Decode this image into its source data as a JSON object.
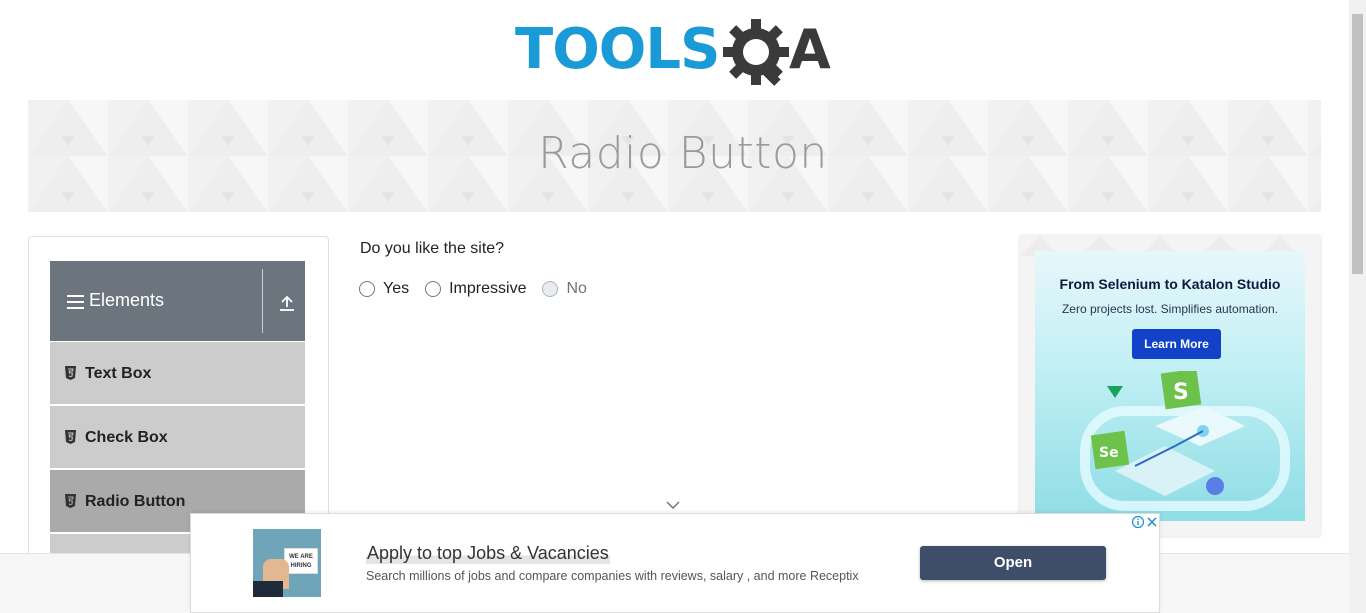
{
  "logo": {
    "text_part1": "TOOLS",
    "text_part2": "A",
    "colors": {
      "blue": "#1b9ad8",
      "dark": "#3a3a3a"
    }
  },
  "banner": {
    "title": "Radio Button"
  },
  "sidebar": {
    "group_title": "Elements",
    "items": [
      {
        "label": "Text Box",
        "active": false
      },
      {
        "label": "Check Box",
        "active": false
      },
      {
        "label": "Radio Button",
        "active": true
      }
    ]
  },
  "main": {
    "question": "Do you like the site?",
    "options": [
      {
        "label": "Yes",
        "disabled": false
      },
      {
        "label": "Impressive",
        "disabled": false
      },
      {
        "label": "No",
        "disabled": true
      }
    ]
  },
  "ad_right": {
    "title": "From Selenium to Katalon Studio",
    "subtitle": "Zero projects lost. Simplifies automation.",
    "button": "Learn More"
  },
  "ad_bottom": {
    "image_text": "WE ARE HIRING",
    "headline": "Apply to top Jobs & Vacancies",
    "description": "Search millions of jobs and compare companies with reviews, salary , and more Receptix",
    "button": "Open"
  }
}
